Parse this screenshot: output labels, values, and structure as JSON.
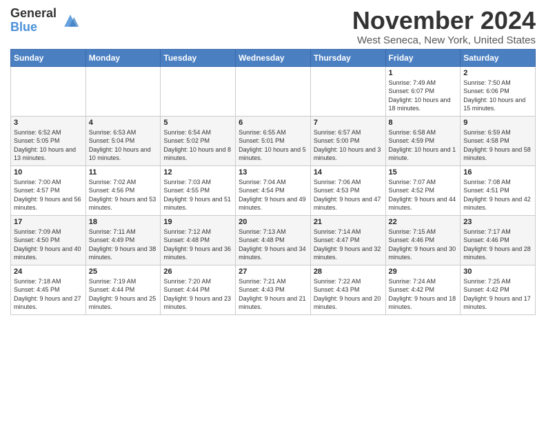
{
  "header": {
    "logo_general": "General",
    "logo_blue": "Blue",
    "month_title": "November 2024",
    "location": "West Seneca, New York, United States"
  },
  "weekdays": [
    "Sunday",
    "Monday",
    "Tuesday",
    "Wednesday",
    "Thursday",
    "Friday",
    "Saturday"
  ],
  "weeks": [
    [
      {
        "day": "",
        "info": ""
      },
      {
        "day": "",
        "info": ""
      },
      {
        "day": "",
        "info": ""
      },
      {
        "day": "",
        "info": ""
      },
      {
        "day": "",
        "info": ""
      },
      {
        "day": "1",
        "info": "Sunrise: 7:49 AM\nSunset: 6:07 PM\nDaylight: 10 hours and 18 minutes."
      },
      {
        "day": "2",
        "info": "Sunrise: 7:50 AM\nSunset: 6:06 PM\nDaylight: 10 hours and 15 minutes."
      }
    ],
    [
      {
        "day": "3",
        "info": "Sunrise: 6:52 AM\nSunset: 5:05 PM\nDaylight: 10 hours and 13 minutes."
      },
      {
        "day": "4",
        "info": "Sunrise: 6:53 AM\nSunset: 5:04 PM\nDaylight: 10 hours and 10 minutes."
      },
      {
        "day": "5",
        "info": "Sunrise: 6:54 AM\nSunset: 5:02 PM\nDaylight: 10 hours and 8 minutes."
      },
      {
        "day": "6",
        "info": "Sunrise: 6:55 AM\nSunset: 5:01 PM\nDaylight: 10 hours and 5 minutes."
      },
      {
        "day": "7",
        "info": "Sunrise: 6:57 AM\nSunset: 5:00 PM\nDaylight: 10 hours and 3 minutes."
      },
      {
        "day": "8",
        "info": "Sunrise: 6:58 AM\nSunset: 4:59 PM\nDaylight: 10 hours and 1 minute."
      },
      {
        "day": "9",
        "info": "Sunrise: 6:59 AM\nSunset: 4:58 PM\nDaylight: 9 hours and 58 minutes."
      }
    ],
    [
      {
        "day": "10",
        "info": "Sunrise: 7:00 AM\nSunset: 4:57 PM\nDaylight: 9 hours and 56 minutes."
      },
      {
        "day": "11",
        "info": "Sunrise: 7:02 AM\nSunset: 4:56 PM\nDaylight: 9 hours and 53 minutes."
      },
      {
        "day": "12",
        "info": "Sunrise: 7:03 AM\nSunset: 4:55 PM\nDaylight: 9 hours and 51 minutes."
      },
      {
        "day": "13",
        "info": "Sunrise: 7:04 AM\nSunset: 4:54 PM\nDaylight: 9 hours and 49 minutes."
      },
      {
        "day": "14",
        "info": "Sunrise: 7:06 AM\nSunset: 4:53 PM\nDaylight: 9 hours and 47 minutes."
      },
      {
        "day": "15",
        "info": "Sunrise: 7:07 AM\nSunset: 4:52 PM\nDaylight: 9 hours and 44 minutes."
      },
      {
        "day": "16",
        "info": "Sunrise: 7:08 AM\nSunset: 4:51 PM\nDaylight: 9 hours and 42 minutes."
      }
    ],
    [
      {
        "day": "17",
        "info": "Sunrise: 7:09 AM\nSunset: 4:50 PM\nDaylight: 9 hours and 40 minutes."
      },
      {
        "day": "18",
        "info": "Sunrise: 7:11 AM\nSunset: 4:49 PM\nDaylight: 9 hours and 38 minutes."
      },
      {
        "day": "19",
        "info": "Sunrise: 7:12 AM\nSunset: 4:48 PM\nDaylight: 9 hours and 36 minutes."
      },
      {
        "day": "20",
        "info": "Sunrise: 7:13 AM\nSunset: 4:48 PM\nDaylight: 9 hours and 34 minutes."
      },
      {
        "day": "21",
        "info": "Sunrise: 7:14 AM\nSunset: 4:47 PM\nDaylight: 9 hours and 32 minutes."
      },
      {
        "day": "22",
        "info": "Sunrise: 7:15 AM\nSunset: 4:46 PM\nDaylight: 9 hours and 30 minutes."
      },
      {
        "day": "23",
        "info": "Sunrise: 7:17 AM\nSunset: 4:46 PM\nDaylight: 9 hours and 28 minutes."
      }
    ],
    [
      {
        "day": "24",
        "info": "Sunrise: 7:18 AM\nSunset: 4:45 PM\nDaylight: 9 hours and 27 minutes."
      },
      {
        "day": "25",
        "info": "Sunrise: 7:19 AM\nSunset: 4:44 PM\nDaylight: 9 hours and 25 minutes."
      },
      {
        "day": "26",
        "info": "Sunrise: 7:20 AM\nSunset: 4:44 PM\nDaylight: 9 hours and 23 minutes."
      },
      {
        "day": "27",
        "info": "Sunrise: 7:21 AM\nSunset: 4:43 PM\nDaylight: 9 hours and 21 minutes."
      },
      {
        "day": "28",
        "info": "Sunrise: 7:22 AM\nSunset: 4:43 PM\nDaylight: 9 hours and 20 minutes."
      },
      {
        "day": "29",
        "info": "Sunrise: 7:24 AM\nSunset: 4:42 PM\nDaylight: 9 hours and 18 minutes."
      },
      {
        "day": "30",
        "info": "Sunrise: 7:25 AM\nSunset: 4:42 PM\nDaylight: 9 hours and 17 minutes."
      }
    ]
  ]
}
